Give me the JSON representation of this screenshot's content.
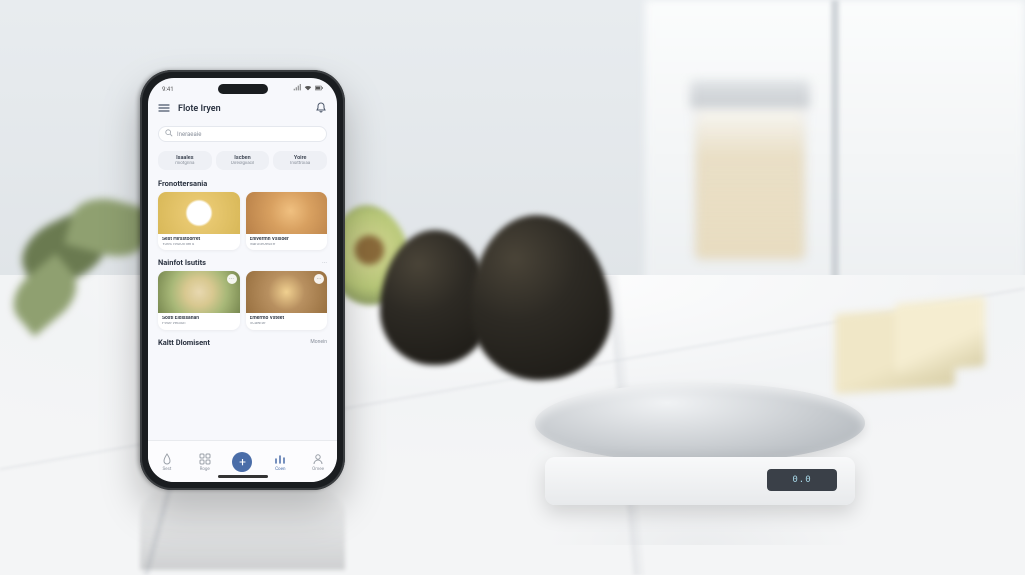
{
  "status": {
    "time": "9:41"
  },
  "header": {
    "menu_icon": "menu-icon",
    "title": "Flote Iryen",
    "action_icon": "bell-icon"
  },
  "search": {
    "placeholder": "Ineraeaie"
  },
  "chips": [
    {
      "title": "Isaales",
      "subtitle": "miotgrina"
    },
    {
      "title": "Iscben",
      "subtitle": "Oireolgiiacil"
    },
    {
      "title": "Yoire",
      "subtitle": "Insittroiaa"
    }
  ],
  "sections": [
    {
      "heading": "Fronottersania",
      "more": "",
      "cards": [
        {
          "title": "Sest Hirsstoorret",
          "subtitle": "Yoes fesiomient",
          "thumb": "f1",
          "badge": ""
        },
        {
          "title": "Enivermn Vsisoer",
          "subtitle": "Naroteoesire",
          "thumb": "f2",
          "badge": ""
        }
      ]
    },
    {
      "heading": "Nainfot Isutits",
      "more": "⋯",
      "cards": [
        {
          "title": "Sosti Eidlssanan",
          "subtitle": "Fese veiash",
          "thumb": "f3",
          "badge": "⋯"
        },
        {
          "title": "Emermo Vsteet",
          "subtitle": "Ircawite",
          "thumb": "f4",
          "badge": "⋯"
        }
      ]
    },
    {
      "heading": "Kaltt Dlomisent",
      "more": "Monein",
      "cards": []
    }
  ],
  "nav": [
    {
      "label": "Sest",
      "icon": "drop-icon",
      "active": false
    },
    {
      "label": "Roge",
      "icon": "grid-icon",
      "active": false
    },
    {
      "label": "",
      "icon": "add-icon",
      "active": false,
      "is_add": true
    },
    {
      "label": "Coen",
      "icon": "chart-icon",
      "active": true
    },
    {
      "label": "Omee",
      "icon": "user-icon",
      "active": false
    }
  ],
  "scale": {
    "display": "0.0"
  }
}
